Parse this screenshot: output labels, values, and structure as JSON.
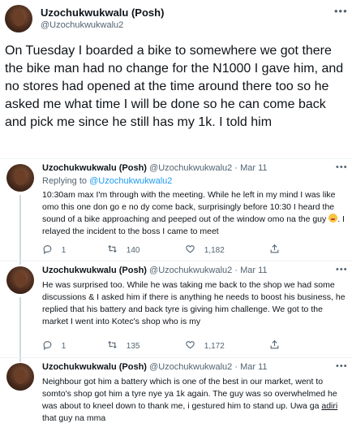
{
  "main_tweet": {
    "name": "Uzochukwukwalu (Posh)",
    "handle": "@Uzochukwukwalu2",
    "text": "On Tuesday I boarded a bike to somewhere we got there the bike man had no change for the N1000 I gave him, and no stores had opened at the time around there too so he asked me what time I will be done so he can come back and pick me since he still has my 1k. I told him"
  },
  "replies": [
    {
      "name": "Uzochukwukwalu (Posh)",
      "handle": "@Uzochukwukwalu2",
      "dot": "·",
      "date": "Mar 11",
      "replying_prefix": "Replying to",
      "replying_to": "@Uzochukwukwalu2",
      "text_before_emoji": "10:30am max I'm through with the meeting. While he left in my mind I was like omo this one don go e no dy come back, surprisingly before 10:30 I heard the sound of a bike approaching and peeped out of the window omo na the guy ",
      "text_after_emoji": ". I relayed the incident to the boss I came to meet",
      "replies": "1",
      "retweets": "140",
      "likes": "1,182"
    },
    {
      "name": "Uzochukwukwalu (Posh)",
      "handle": "@Uzochukwukwalu2",
      "dot": "·",
      "date": "Mar 11",
      "text": "He was surprised too. While he was taking me back to the shop we had some discussions & I asked him if there is anything he needs to boost his business, he replied that his battery and back tyre is giving him challenge. We got to the market I went into Kotec's shop who is my",
      "replies": "1",
      "retweets": "135",
      "likes": "1,172"
    },
    {
      "name": "Uzochukwukwalu (Posh)",
      "handle": "@Uzochukwukwalu2",
      "dot": "·",
      "date": "Mar 11",
      "text_before_underline": "Neighbour got him a battery which is one of the best in our market, went to somto's shop got him a tyre nye ya 1k again. The guy was so overwhelmed he was about to kneel down to thank me, i gestured him to stand up. Uwa ga ",
      "text_underlined": "adiri",
      "text_after_underline": " that guy na mma"
    }
  ],
  "icons": {
    "more": "more-horizontal-icon",
    "reply": "reply-icon",
    "retweet": "retweet-icon",
    "like": "heart-icon",
    "emoji": "flushed-face-emoji"
  },
  "colors": {
    "text": "#0f1419",
    "secondary": "#536471",
    "link": "#1d9bf0",
    "divider": "#eff3f4"
  }
}
